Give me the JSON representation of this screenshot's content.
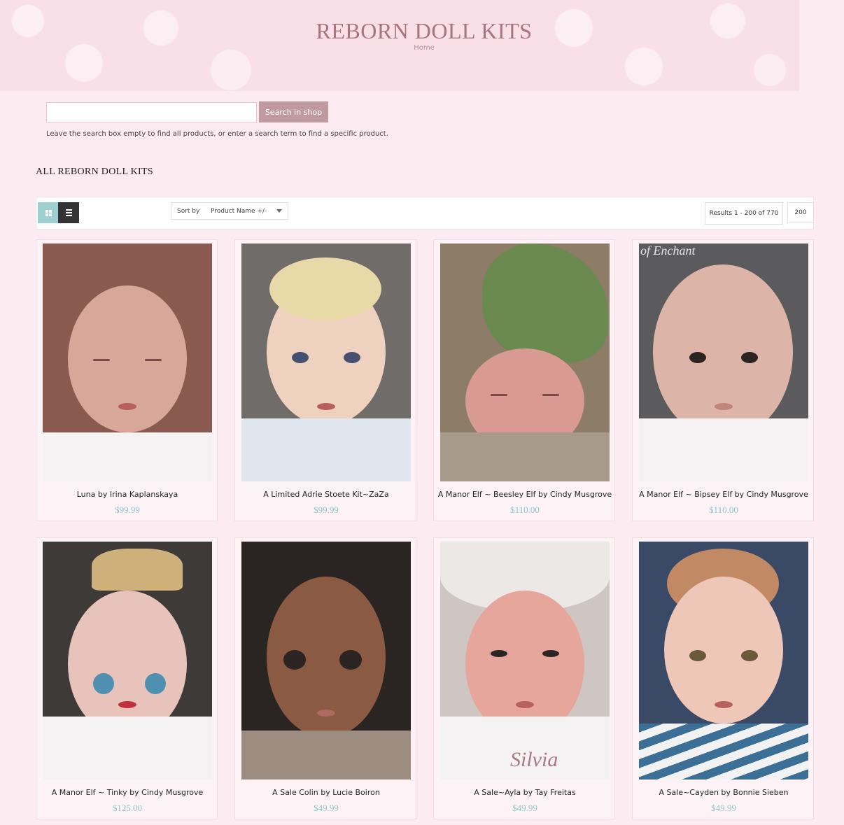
{
  "header": {
    "title": "REBORN DOLL KITS",
    "breadcrumb": "Home"
  },
  "search": {
    "value": "",
    "placeholder": "",
    "button_label": "Search in shop",
    "hint": "Leave the search box empty to find all products, or enter a search term to find a specific product."
  },
  "section": {
    "title": "ALL REBORN DOLL KITS"
  },
  "toolbar": {
    "view_grid_icon": "grid-view-icon",
    "view_list_icon": "list-view-icon",
    "sort_label": "Sort by",
    "sort_value": "Product Name +/-",
    "results": "Results 1 - 200 of 770",
    "per_page": "200"
  },
  "colors": {
    "page_bg": "#fcebf1",
    "accent_button": "#bf9aa0",
    "price": "#8fc7c9",
    "title": "#a8757f"
  },
  "products": [
    {
      "name": "Luna by Irina Kaplanskaya",
      "price": "$99.99"
    },
    {
      "name": "A Limited Adrie Stoete Kit~ZaZa",
      "price": "$99.99"
    },
    {
      "name": "A Manor Elf ~ Beesley Elf by Cindy Musgrove",
      "price": "$110.00"
    },
    {
      "name": "A Manor Elf ~ Bipsey Elf by Cindy Musgrove",
      "price": "$110.00"
    },
    {
      "name": "A Manor Elf ~ Tinky by Cindy Musgrove",
      "price": "$125.00"
    },
    {
      "name": "A Sale Colin by Lucie Boiron",
      "price": "$49.99"
    },
    {
      "name": "A Sale~Ayla by Tay Freitas",
      "price": "$49.99"
    },
    {
      "name": "A Sale~Cayden by Bonnie Sieben",
      "price": "$49.99"
    }
  ],
  "watermarks": {
    "card4": "of Enchant",
    "card7": "Silvia"
  }
}
